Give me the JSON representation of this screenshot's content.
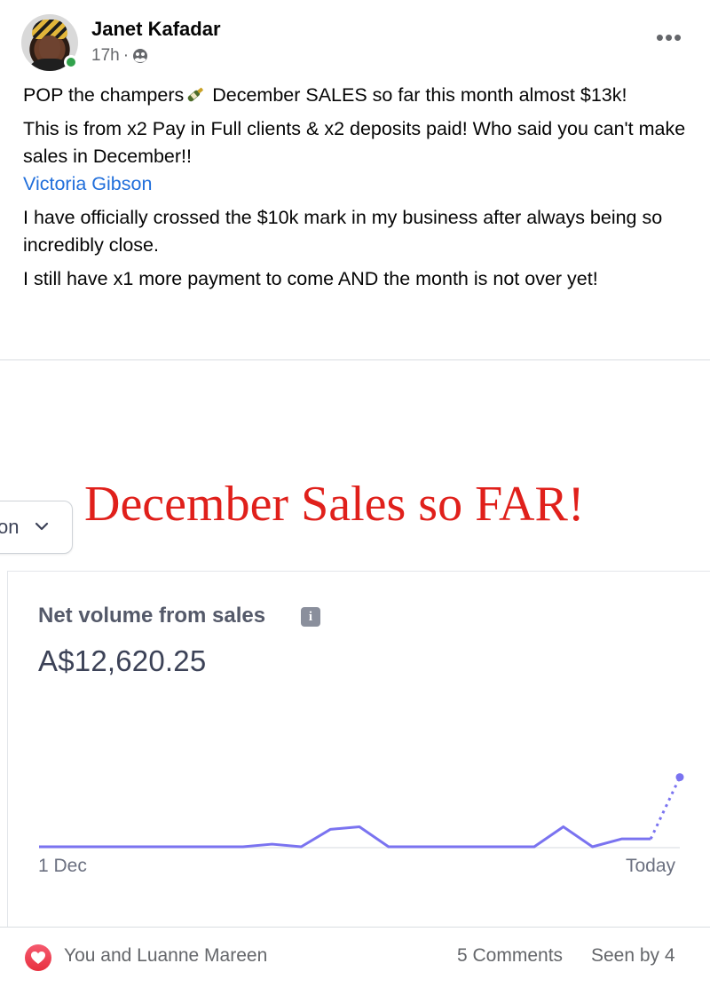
{
  "post": {
    "author": "Janet Kafadar",
    "time": "17h",
    "separator": "·",
    "audience_icon": "friends-icon",
    "more_label": "•••",
    "paragraph1_a": "POP the champers",
    "paragraph1_b": " December SALES so far this month almost $13k!",
    "paragraph2": "This is from x2 Pay in Full clients & x2 deposits paid! Who said you can't make sales in December!!",
    "mention": "Victoria Gibson",
    "paragraph3": "I have officially crossed the $10k mark in my business after always being so incredibly close.",
    "paragraph4": "I still have x1 more payment to come AND the month is not over yet!"
  },
  "media": {
    "overlay_title": "December Sales so FAR!",
    "dropdown_label": "on",
    "metric_label": "Net volume from sales",
    "metric_value": "A$12,620.25",
    "x_start": "1 Dec",
    "x_end": "Today"
  },
  "chart_data": {
    "type": "line",
    "x": [
      "1 Dec",
      "Today"
    ],
    "series": [
      {
        "values": [
          0,
          0,
          0,
          0,
          0,
          0,
          0,
          0,
          0.03,
          0,
          0.2,
          0.23,
          0,
          0,
          0,
          0,
          0,
          0,
          0.23,
          0,
          0.09,
          0.09,
          0.8
        ],
        "projected_from_index": 21
      }
    ],
    "line_color": "#7a73f0"
  },
  "footer": {
    "reactions_label": "You and Luanne Mareen",
    "comments": "5 Comments",
    "seen": "Seen by 4"
  }
}
